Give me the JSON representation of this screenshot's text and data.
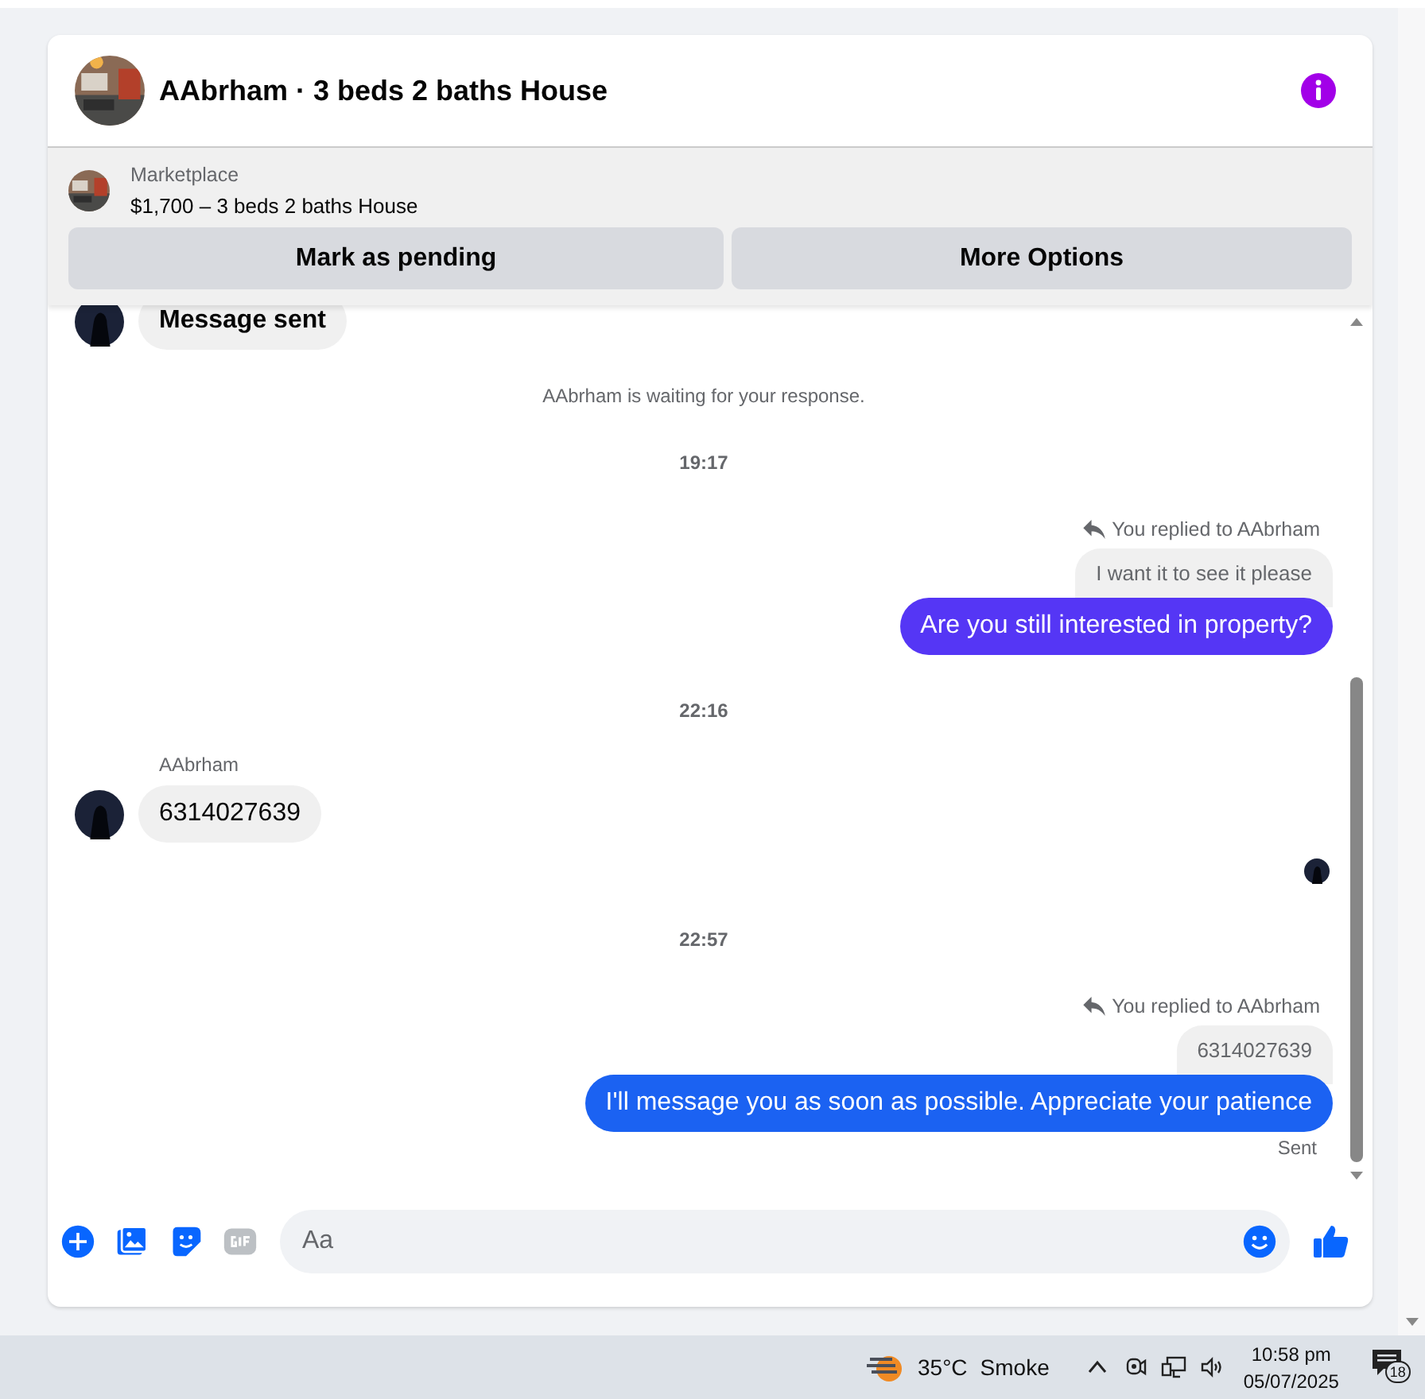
{
  "conversation": {
    "title": "AAbrham · 3 beds 2 baths House"
  },
  "listing": {
    "source": "Marketplace",
    "title": "$1,700 – 3 beds 2 baths House",
    "buttons": [
      "Mark as pending",
      "More Options"
    ]
  },
  "messages": [
    {
      "kind": "incoming",
      "text": "Message sent"
    },
    {
      "kind": "system",
      "text": "AAbrham is waiting for your response."
    },
    {
      "kind": "time",
      "text": "19:17"
    },
    {
      "kind": "outgoing",
      "reply_note": "You replied to AAbrham",
      "quote": "I want it to see it please",
      "text": "Are you still interested in property?",
      "color": "#5536f5"
    },
    {
      "kind": "time",
      "text": "22:16"
    },
    {
      "kind": "incoming",
      "sender": "AAbrham",
      "text": "6314027639"
    },
    {
      "kind": "seen"
    },
    {
      "kind": "time",
      "text": "22:57"
    },
    {
      "kind": "outgoing",
      "reply_note": "You replied to AAbrham",
      "quote": "6314027639",
      "text": "I'll message you as soon as possible. Appreciate your patience",
      "color": "#1b62f2",
      "status": "Sent"
    }
  ],
  "composer": {
    "placeholder": "Aa"
  },
  "taskbar": {
    "temperature": "35°C",
    "weather": "Smoke",
    "time": "10:58 pm",
    "date": "05/07/2025",
    "notifications": "18"
  }
}
